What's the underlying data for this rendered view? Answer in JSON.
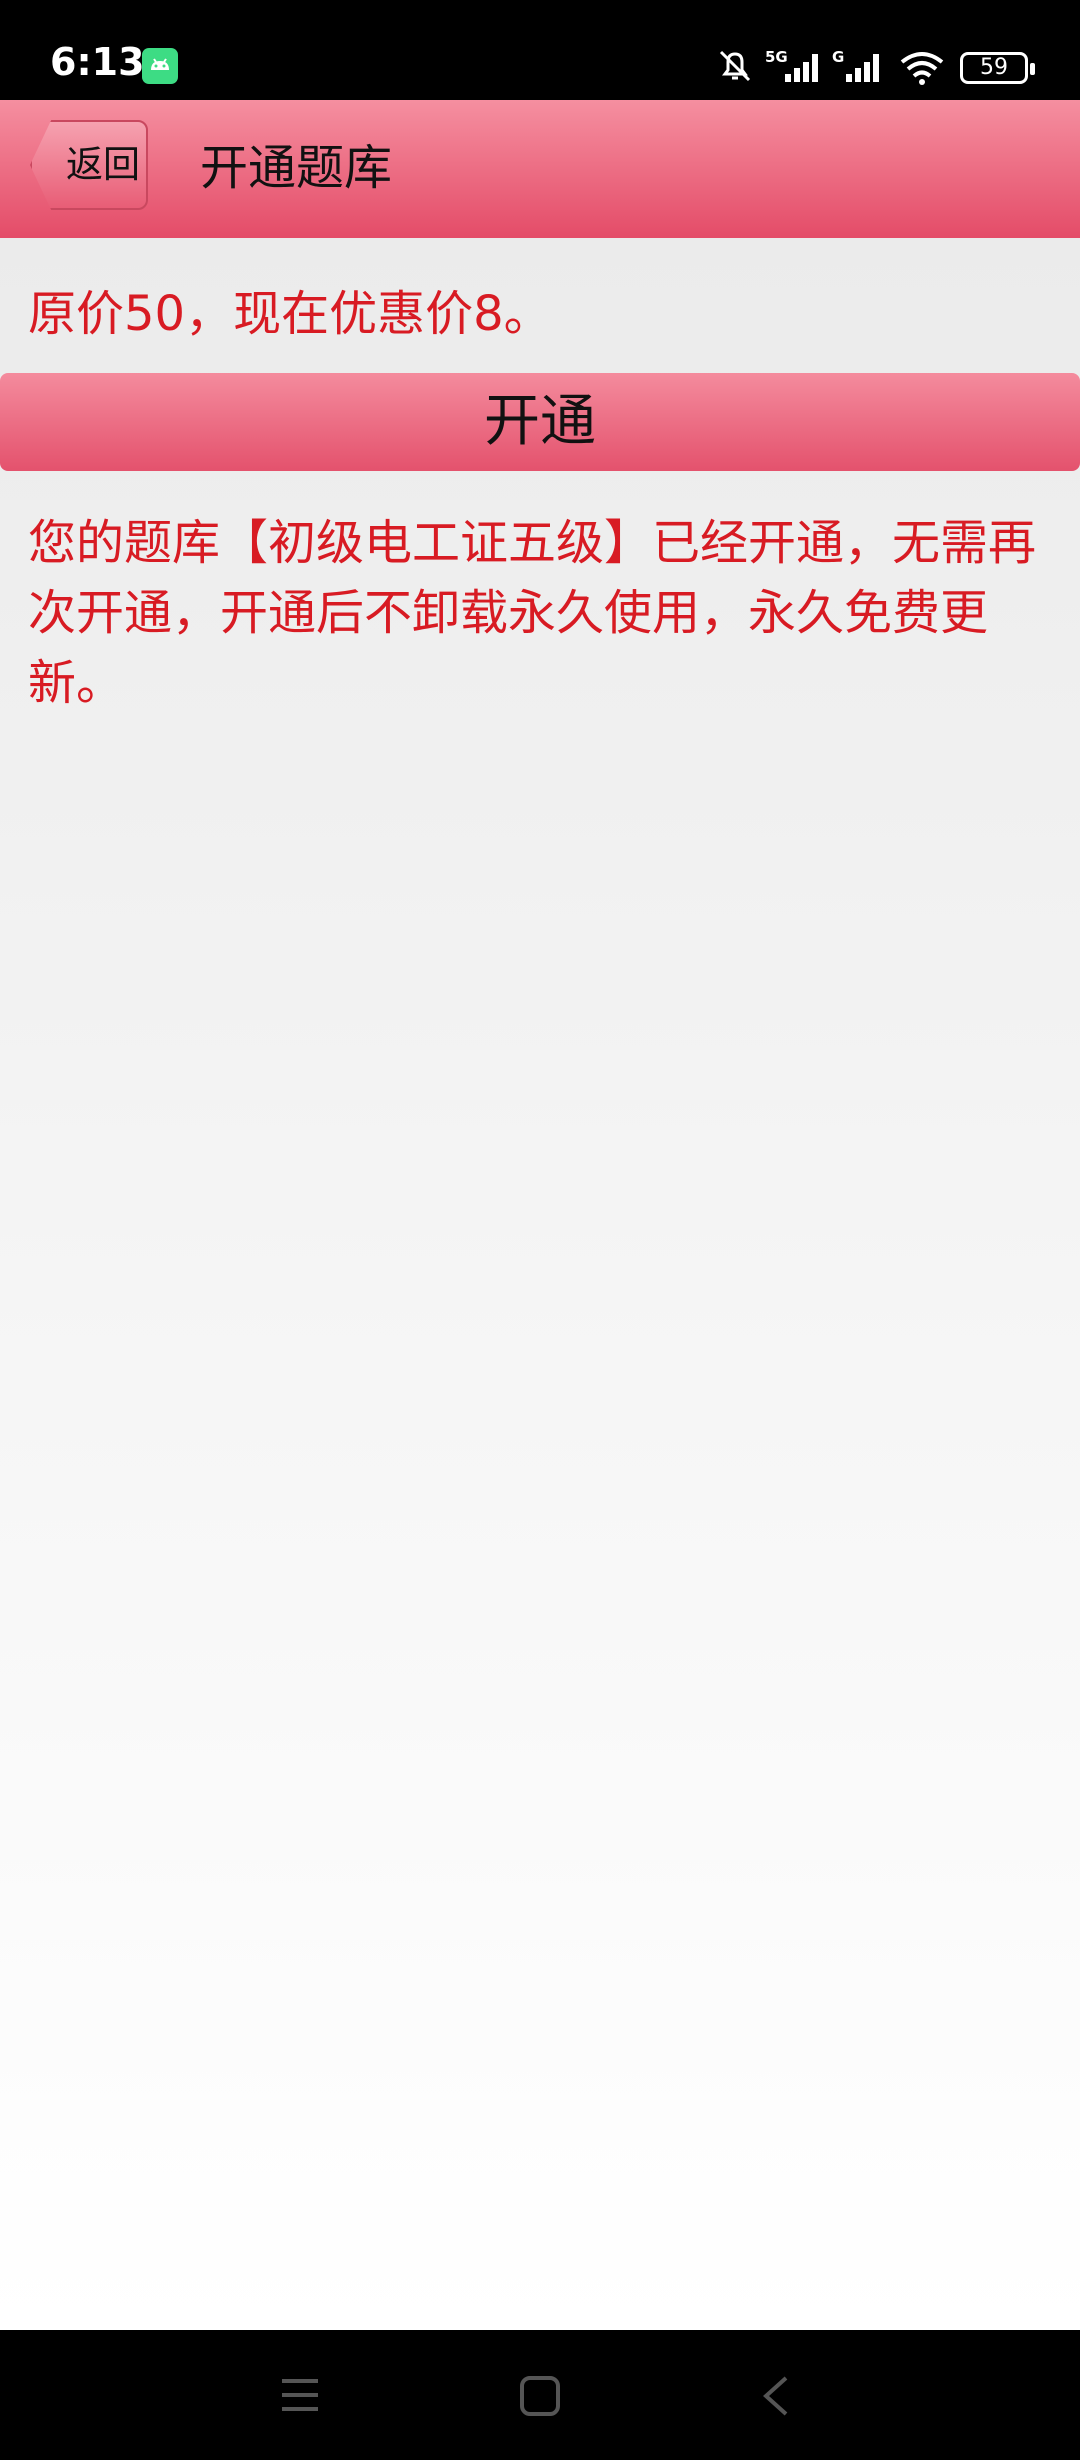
{
  "status_bar": {
    "time": "6:13",
    "battery": "59",
    "signal_1": "5G",
    "signal_2": "G",
    "icons": [
      "android-icon",
      "mute-bell-icon",
      "signal-5g-icon",
      "signal-g-icon",
      "wifi-icon",
      "battery-icon"
    ]
  },
  "header": {
    "back_label": "返回",
    "title": "开通题库"
  },
  "main": {
    "price_text": "原价50，现在优惠价8。",
    "open_button_label": "开通",
    "info_text": "您的题库【初级电工证五级】已经开通，无需再次开通，开通后不卸载永久使用，永久免费更新。"
  },
  "nav_bar": {
    "icons": [
      "menu-icon",
      "home-icon",
      "back-arrow-icon"
    ]
  },
  "colors": {
    "accent": "#e44c68",
    "text_red": "#d81b23",
    "status_bg": "#000000"
  }
}
